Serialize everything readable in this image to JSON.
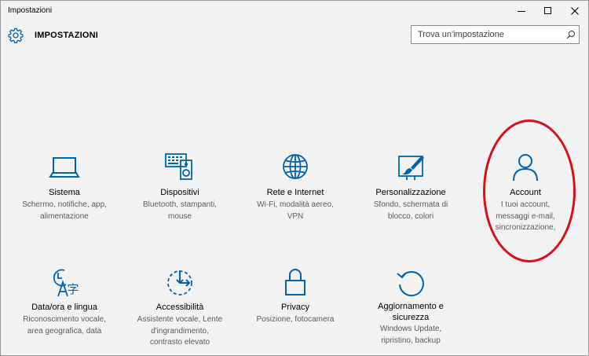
{
  "window": {
    "title": "Impostazioni",
    "accent_color": "#0063b1"
  },
  "header": {
    "app_title": "IMPOSTAZIONI",
    "search_placeholder": "Trova un'impostazione"
  },
  "icons": {
    "settings": "gear-icon",
    "search": "magnifier-icon",
    "minimize": "minimize-icon",
    "maximize": "maximize-icon",
    "close": "close-icon"
  },
  "tiles": [
    {
      "label": "Sistema",
      "desc": [
        "Schermo, notifiche, app,",
        "alimentazione"
      ],
      "icon": "laptop-icon"
    },
    {
      "label": "Dispositivi",
      "desc": [
        "Bluetooth, stampanti,",
        "mouse"
      ],
      "icon": "keyboard-speaker-icon"
    },
    {
      "label": "Rete e Internet",
      "desc": [
        "Wi-Fi, modalità aereo,",
        "VPN"
      ],
      "icon": "globe-icon"
    },
    {
      "label": "Personalizzazione",
      "desc": [
        "Sfondo, schermata di",
        "blocco, colori"
      ],
      "icon": "paint-brush-icon"
    },
    {
      "label": "Account",
      "desc": [
        "I tuoi account,",
        "messaggi e-mail,",
        "sincronizzazione,"
      ],
      "icon": "person-icon"
    },
    {
      "label": "Data/ora e lingua",
      "desc": [
        "Riconoscimento vocale,",
        "area geografica, data"
      ],
      "icon": "time-language-icon"
    },
    {
      "label": "Accessibilità",
      "desc": [
        "Assistente vocale, Lente",
        "d'ingrandimento,",
        "contrasto elevato"
      ],
      "icon": "ease-of-access-icon"
    },
    {
      "label": "Privacy",
      "desc": [
        "Posizione, fotocamera"
      ],
      "icon": "lock-icon"
    },
    {
      "label": "Aggiornamento e sicurezza",
      "label_lines": [
        "Aggiornamento e",
        "sicurezza"
      ],
      "desc": [
        "Windows Update,",
        "ripristino, backup"
      ],
      "icon": "refresh-icon"
    }
  ],
  "annotation": {
    "highlight_color": "#d8101c",
    "highlighted_tile": "Account"
  }
}
